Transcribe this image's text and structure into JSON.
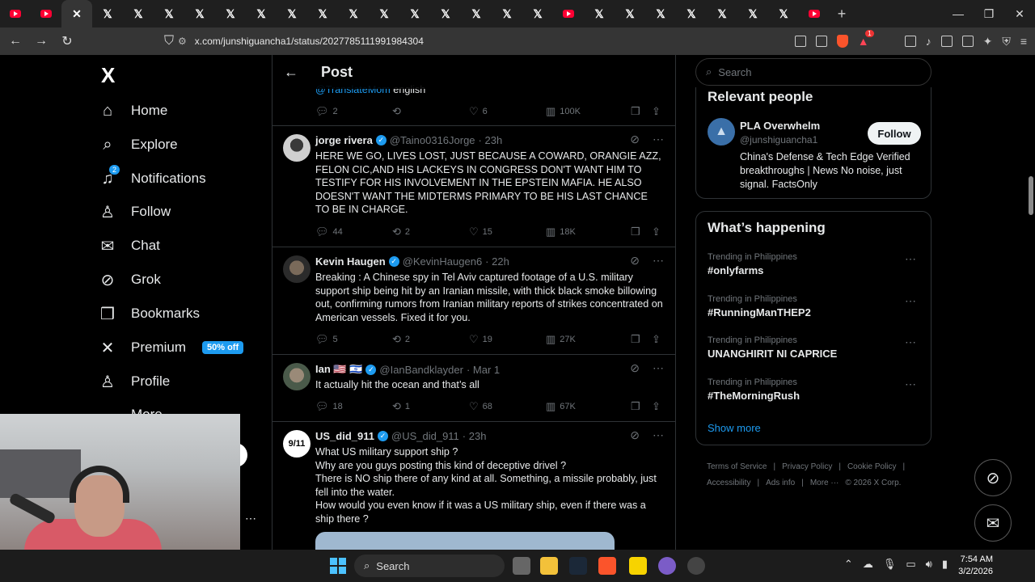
{
  "browser": {
    "url": "x.com/junshiguancha1/status/2027785111991984304",
    "brave_badge": "1"
  },
  "left_nav": {
    "logo": "X",
    "items": [
      {
        "label": "Home",
        "icon": "home-icon",
        "glyph": "⌂"
      },
      {
        "label": "Explore",
        "icon": "search-icon",
        "glyph": "⌕"
      },
      {
        "label": "Notifications",
        "icon": "bell-icon",
        "glyph": "♫",
        "badge": "2"
      },
      {
        "label": "Follow",
        "icon": "follow-icon",
        "glyph": "♙"
      },
      {
        "label": "Chat",
        "icon": "mail-icon",
        "glyph": "✉"
      },
      {
        "label": "Grok",
        "icon": "grok-icon",
        "glyph": "⊘"
      },
      {
        "label": "Bookmarks",
        "icon": "bookmark-icon",
        "glyph": "❒"
      },
      {
        "label": "Premium",
        "icon": "x-icon",
        "glyph": "✕",
        "badge_text": "50% off"
      },
      {
        "label": "Profile",
        "icon": "profile-icon",
        "glyph": "♙"
      },
      {
        "label": "More",
        "icon": "more-icon",
        "glyph": "⋯"
      }
    ]
  },
  "timeline": {
    "title": "Post",
    "partial_tweet": {
      "text_mention": "@TranslateMom",
      "text_rest": " english",
      "replies": "2",
      "reposts": "",
      "likes": "6",
      "views": "100K"
    },
    "tweets": [
      {
        "name": "jorge rivera",
        "handle": "@Taino0316Jorge",
        "time": "· 23h",
        "text": "HERE WE GO, LIVES LOST, JUST BECAUSE A COWARD, ORANGIE AZZ, FELON CIC,AND HIS LACKEYS IN CONGRESS DON'T WANT HIM TO TESTIFY FOR HIS INVOLVEMENT IN THE EPSTEIN MAFIA. HE ALSO DOESN'T WANT THE MIDTERMS PRIMARY TO BE  HIS LAST CHANCE TO BE IN CHARGE.",
        "replies": "44",
        "reposts": "2",
        "likes": "15",
        "views": "18K"
      },
      {
        "name": "Kevin Haugen",
        "handle": "@KevinHaugen6",
        "time": "· 22h",
        "text": "Breaking : A Chinese spy in Tel Aviv captured footage of a U.S. military support ship being hit by an Iranian missile, with thick black smoke billowing out, confirming rumors from Iranian military reports of strikes concentrated on American vessels.  Fixed it for you.",
        "replies": "5",
        "reposts": "2",
        "likes": "19",
        "views": "27K"
      },
      {
        "name": "Ian 🇺🇸 🇮🇱",
        "handle": "@IanBandklayder",
        "time": "· Mar 1",
        "text": "It actually hit the ocean and that’s all",
        "replies": "18",
        "reposts": "1",
        "likes": "68",
        "views": "67K"
      },
      {
        "name": "US_did_911",
        "handle": "@US_did_911",
        "time": "· 23h",
        "lines": [
          "What US military support ship ?",
          "Why are you guys posting this kind of deceptive drivel ?",
          "There is NO ship there of any kind at all. Something, a missile probably, just fell into the water.",
          "How would you even know if it was a US military ship, even if there was a ship there ?"
        ]
      }
    ]
  },
  "right_col": {
    "search_placeholder": "Search",
    "relevant": {
      "title": "Relevant people",
      "name": "PLA Overwhelm",
      "handle": "@junshiguancha1",
      "follow_label": "Follow",
      "bio": "China's Defense & Tech Edge Verified breakthroughs | News No noise, just signal. FactsOnly"
    },
    "happening": {
      "title": "What’s happening",
      "trends": [
        {
          "context": "Trending in Philippines",
          "topic": "#onlyfarms"
        },
        {
          "context": "Trending in Philippines",
          "topic": "#RunningManTHEP2"
        },
        {
          "context": "Trending in Philippines",
          "topic": "UNANGHIRIT NI CAPRICE"
        },
        {
          "context": "Trending in Philippines",
          "topic": "#TheMorningRush"
        }
      ],
      "show_more": "Show more"
    },
    "footer": [
      "Terms of Service",
      "|",
      "Privacy Policy",
      "|",
      "Cookie Policy",
      "|",
      "Accessibility",
      "|",
      "Ads info",
      "|",
      "More ···",
      "© 2026 X Corp."
    ]
  },
  "taskbar": {
    "search_label": "Search",
    "time": "7:54 AM",
    "date": "3/2/2026"
  },
  "colors": {
    "accent": "#1d9bf0",
    "muted": "#71767b",
    "border": "#2f3336"
  }
}
